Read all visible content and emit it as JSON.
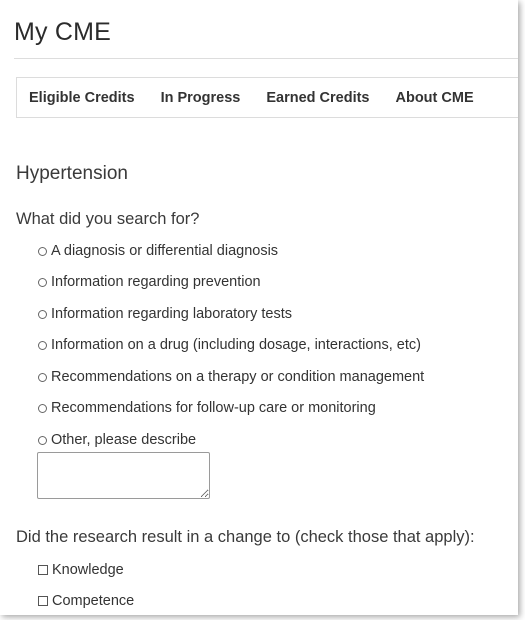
{
  "header": {
    "title": "My CME"
  },
  "tabs": [
    {
      "label": "Eligible Credits"
    },
    {
      "label": "In Progress"
    },
    {
      "label": "Earned Credits"
    },
    {
      "label": "About CME"
    }
  ],
  "form": {
    "topic": "Hypertension",
    "search_question": "What did you search for?",
    "search_options": [
      {
        "label": "A diagnosis or differential diagnosis",
        "selected": false
      },
      {
        "label": "Information regarding prevention",
        "selected": false
      },
      {
        "label": "Information regarding laboratory tests",
        "selected": false
      },
      {
        "label": "Information on a drug (including dosage, interactions, etc)",
        "selected": false
      },
      {
        "label": "Recommendations on a therapy or condition management",
        "selected": false
      },
      {
        "label": "Recommendations for follow-up care or monitoring",
        "selected": false
      },
      {
        "label": "Other, please describe",
        "selected": false
      }
    ],
    "other_description": {
      "value": "",
      "placeholder": ""
    },
    "change_question": "Did the research result in a change to (check those that apply):",
    "change_options": [
      {
        "label": "Knowledge",
        "checked": false
      },
      {
        "label": "Competence",
        "checked": false
      }
    ]
  }
}
